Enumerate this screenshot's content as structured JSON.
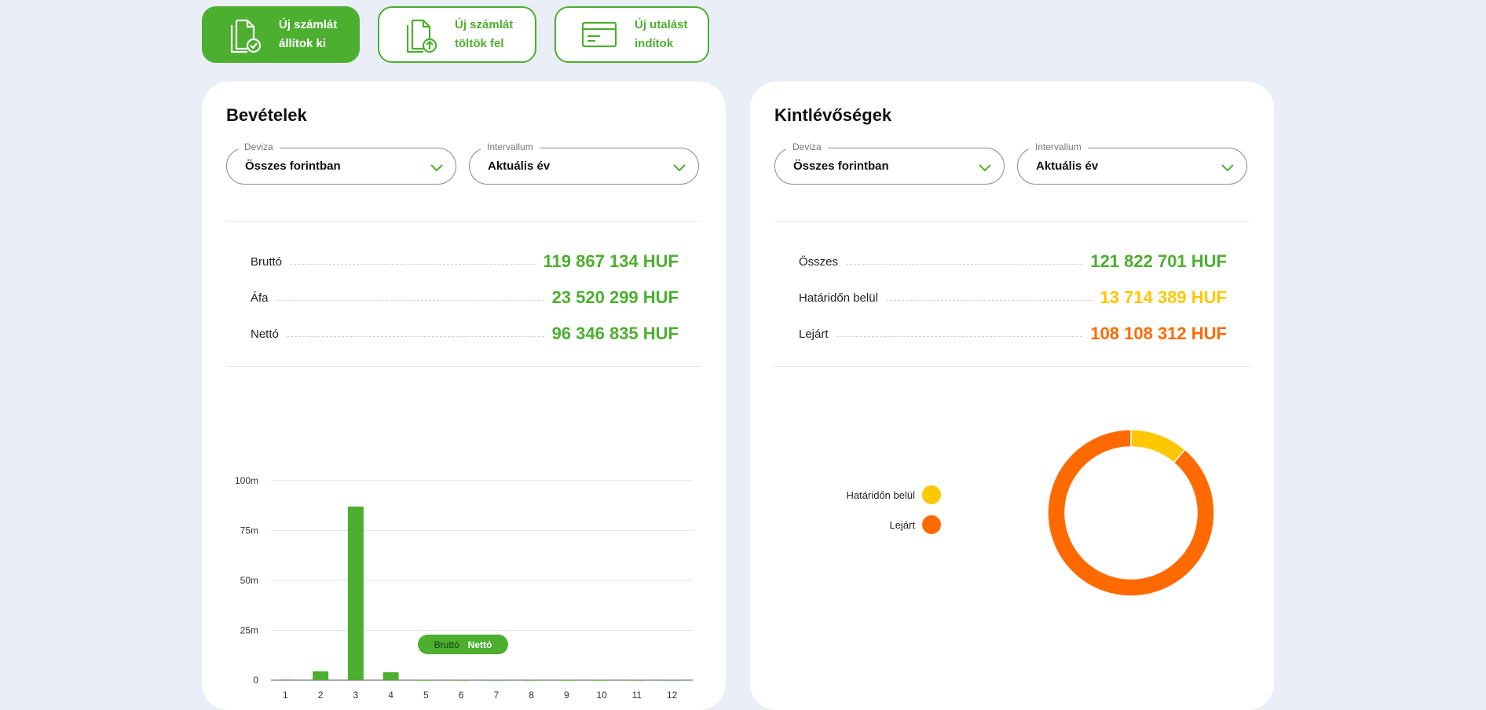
{
  "actions": [
    {
      "label_line1": "Új számlát",
      "label_line2": "állítok ki",
      "icon": "document-check-icon",
      "primary": true
    },
    {
      "label_line1": "Új számlát",
      "label_line2": "töltök fel",
      "icon": "document-upload-icon",
      "primary": false
    },
    {
      "label_line1": "Új utalást",
      "label_line2": "indítok",
      "icon": "card-icon",
      "primary": false
    }
  ],
  "income": {
    "title": "Bevételek",
    "currency_select": {
      "label": "Deviza",
      "value": "Összes forintban"
    },
    "interval_select": {
      "label": "Intervallum",
      "value": "Aktuális év"
    },
    "rows": [
      {
        "label": "Bruttó",
        "value": "119 867 134 HUF"
      },
      {
        "label": "Áfa",
        "value": "23 520 299 HUF"
      },
      {
        "label": "Nettó",
        "value": "96 346 835 HUF"
      }
    ],
    "legend": {
      "brutto": "Bruttó",
      "netto": "Nettó"
    }
  },
  "receivables": {
    "title": "Kintlévőségek",
    "currency_select": {
      "label": "Deviza",
      "value": "Összes forintban"
    },
    "interval_select": {
      "label": "Intervallum",
      "value": "Aktuális év"
    },
    "rows": [
      {
        "label": "Összes",
        "value": "121 822 701 HUF"
      },
      {
        "label": "Határidőn belül",
        "value": "13 714 389 HUF"
      },
      {
        "label": "Lejárt",
        "value": "108 108 312 HUF"
      }
    ],
    "legend": [
      {
        "label": "Határidőn belül",
        "color": "#ffc700"
      },
      {
        "label": "Lejárt",
        "color": "#ff6a00"
      }
    ]
  },
  "colors": {
    "green": "#4caf2f",
    "yellow": "#ffc700",
    "orange": "#ff6a00"
  },
  "chart_data": [
    {
      "type": "bar",
      "categories": [
        "1",
        "2",
        "3",
        "4",
        "5",
        "6",
        "7",
        "8",
        "9",
        "10",
        "11",
        "12"
      ],
      "series": [
        {
          "name": "Nettó",
          "values": [
            0.3,
            4.5,
            87,
            4,
            0,
            0,
            0,
            0,
            0,
            0,
            0,
            0
          ]
        }
      ],
      "ylim": [
        0,
        100
      ],
      "yticks": [
        "0",
        "25m",
        "50m",
        "75m",
        "100m"
      ],
      "ytick_values": [
        0,
        25,
        50,
        75,
        100
      ],
      "grid": true
    },
    {
      "type": "pie",
      "categories": [
        "Határidőn belül",
        "Lejárt"
      ],
      "values": [
        13714389,
        108108312
      ],
      "legend": "left"
    }
  ]
}
